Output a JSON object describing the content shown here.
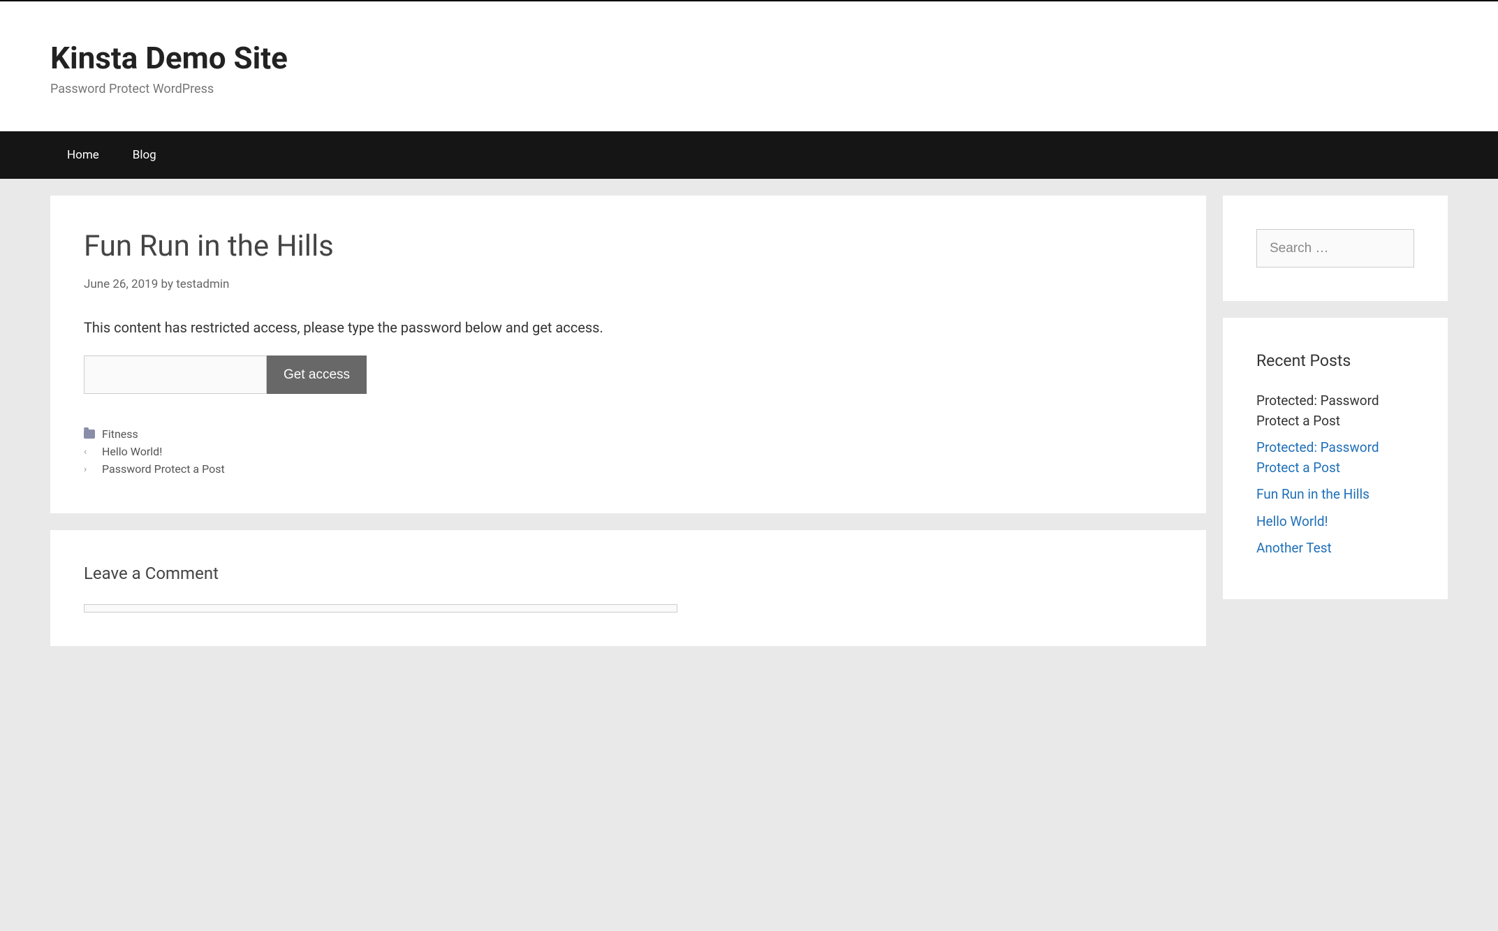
{
  "header": {
    "title": "Kinsta Demo Site",
    "tagline": "Password Protect WordPress"
  },
  "nav": {
    "items": [
      {
        "label": "Home"
      },
      {
        "label": "Blog"
      }
    ]
  },
  "post": {
    "title": "Fun Run in the Hills",
    "date": "June 26, 2019",
    "byText": "by",
    "author": "testadmin",
    "restrictedMessage": "This content has restricted access, please type the password below and get access.",
    "accessButton": "Get access",
    "category": "Fitness",
    "prevPost": "Hello World!",
    "nextPost": "Password Protect a Post"
  },
  "comments": {
    "title": "Leave a Comment"
  },
  "sidebar": {
    "searchPlaceholder": "Search …",
    "recentTitle": "Recent Posts",
    "recentPosts": [
      {
        "label": "Protected: Password Protect a Post"
      },
      {
        "label": "Protected: Password Protect a Post"
      },
      {
        "label": "Fun Run in the Hills"
      },
      {
        "label": "Hello World!"
      },
      {
        "label": "Another Test"
      }
    ]
  }
}
